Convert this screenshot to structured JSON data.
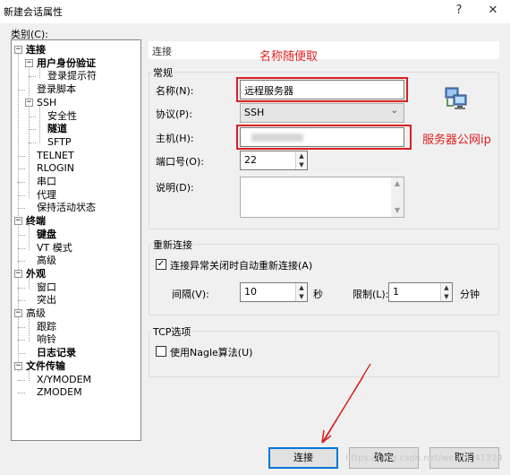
{
  "window": {
    "title": "新建会话属性",
    "help_button": "?",
    "close_button": "✕"
  },
  "category": {
    "label": "类别(C):",
    "tree": [
      {
        "label": "连接",
        "bold": true,
        "expander": "−"
      },
      {
        "label": "用户身份验证",
        "bold": true,
        "expander": "−"
      },
      {
        "label": "登录提示符",
        "bold": false
      },
      {
        "label": "登录脚本",
        "bold": false
      },
      {
        "label": "SSH",
        "bold": false,
        "expander": "−"
      },
      {
        "label": "安全性",
        "bold": false
      },
      {
        "label": "隧道",
        "bold": true
      },
      {
        "label": "SFTP",
        "bold": false
      },
      {
        "label": "TELNET",
        "bold": false
      },
      {
        "label": "RLOGIN",
        "bold": false
      },
      {
        "label": "串口",
        "bold": false
      },
      {
        "label": "代理",
        "bold": false
      },
      {
        "label": "保持活动状态",
        "bold": false
      },
      {
        "label": "终端",
        "bold": true,
        "expander": "−"
      },
      {
        "label": "键盘",
        "bold": true
      },
      {
        "label": "VT 模式",
        "bold": false
      },
      {
        "label": "高级",
        "bold": false
      },
      {
        "label": "外观",
        "bold": true,
        "expander": "−"
      },
      {
        "label": "窗口",
        "bold": false
      },
      {
        "label": "突出",
        "bold": false
      },
      {
        "label": "高级",
        "bold": false,
        "expander": "−"
      },
      {
        "label": "跟踪",
        "bold": false
      },
      {
        "label": "响铃",
        "bold": false
      },
      {
        "label": "日志记录",
        "bold": true
      },
      {
        "label": "文件传输",
        "bold": true,
        "expander": "−"
      },
      {
        "label": "X/YMODEM",
        "bold": false
      },
      {
        "label": "ZMODEM",
        "bold": false
      }
    ]
  },
  "panel": {
    "title": "连接",
    "general": {
      "legend": "常规",
      "name_label": "名称(N):",
      "name_value": "远程服务器",
      "protocol_label": "协议(P):",
      "protocol_value": "SSH",
      "host_label": "主机(H):",
      "host_value": "",
      "port_label": "端口号(O):",
      "port_value": "22",
      "desc_label": "说明(D):",
      "desc_value": ""
    },
    "reconnect": {
      "legend": "重新连接",
      "auto_label": "连接异常关闭时自动重新连接(A)",
      "auto_checked": "✓",
      "interval_label": "间隔(V):",
      "interval_value": "10",
      "interval_unit": "秒",
      "limit_label": "限制(L):",
      "limit_value": "1",
      "limit_unit": "分钟"
    },
    "tcp": {
      "legend": "TCP选项",
      "nagle_label": "使用Nagle算法(U)"
    }
  },
  "annotations": {
    "name_note": "名称随便取",
    "host_note": "服务器公网ip",
    "color": "#e02020"
  },
  "buttons": {
    "connect": "连接",
    "ok": "确定",
    "cancel": "取消"
  },
  "watermark": "https://blog.csdn.net/weixin_41324"
}
